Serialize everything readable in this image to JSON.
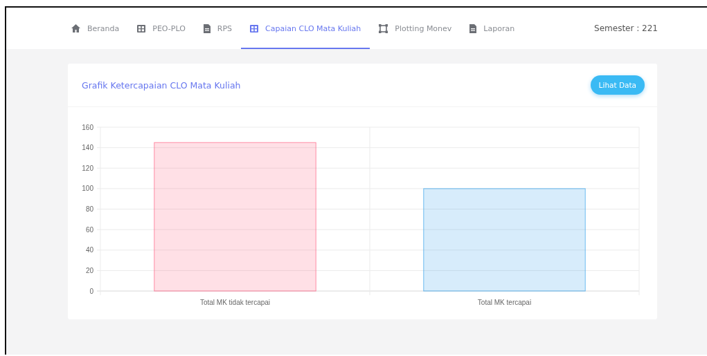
{
  "nav": {
    "tabs": [
      {
        "label": "Beranda",
        "kind": "home",
        "selected": false
      },
      {
        "label": "PEO-PLO",
        "kind": "grid",
        "selected": false
      },
      {
        "label": "RPS",
        "kind": "doc",
        "selected": false
      },
      {
        "label": "Capaian CLO Mata Kuliah",
        "kind": "grid",
        "selected": true
      },
      {
        "label": "Plotting Monev",
        "kind": "frame",
        "selected": false
      },
      {
        "label": "Laporan",
        "kind": "doc",
        "selected": false
      }
    ],
    "semester": "Semester : 221"
  },
  "card": {
    "title": "Grafik Ketercapaian CLO Mata Kuliah",
    "button": "Lihat Data",
    "chart_data": {
      "type": "bar",
      "categories": [
        "Total MK tidak tercapai",
        "Total MK tercapai"
      ],
      "grid": true,
      "series": [
        {
          "colors": [
            "#ff6384",
            "#36a2eb"
          ],
          "values": [
            145,
            100
          ]
        }
      ],
      "ylim": [
        0,
        160
      ],
      "yticks": [
        0,
        20,
        40,
        60,
        80,
        100,
        120,
        140,
        160
      ]
    }
  }
}
